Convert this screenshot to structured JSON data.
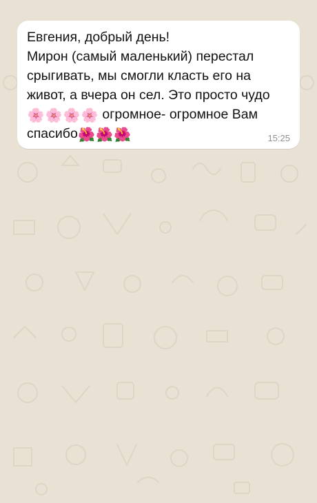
{
  "chat": {
    "background_color": "#e8e1d4",
    "message": {
      "lines": [
        "Евгения, добрый день!",
        "Мирон (самый маленький) перестал",
        "срыгивать, мы смогли класть его на",
        "живот, а вчера он сел. Это просто чудо"
      ],
      "line5_text": " огромное- огромное Вам",
      "line6_text": "спасибо",
      "emoji_blossom": "🌸",
      "emoji_hibiscus": "🌺",
      "time": "15:25",
      "bubble_color": "#ffffff"
    }
  }
}
